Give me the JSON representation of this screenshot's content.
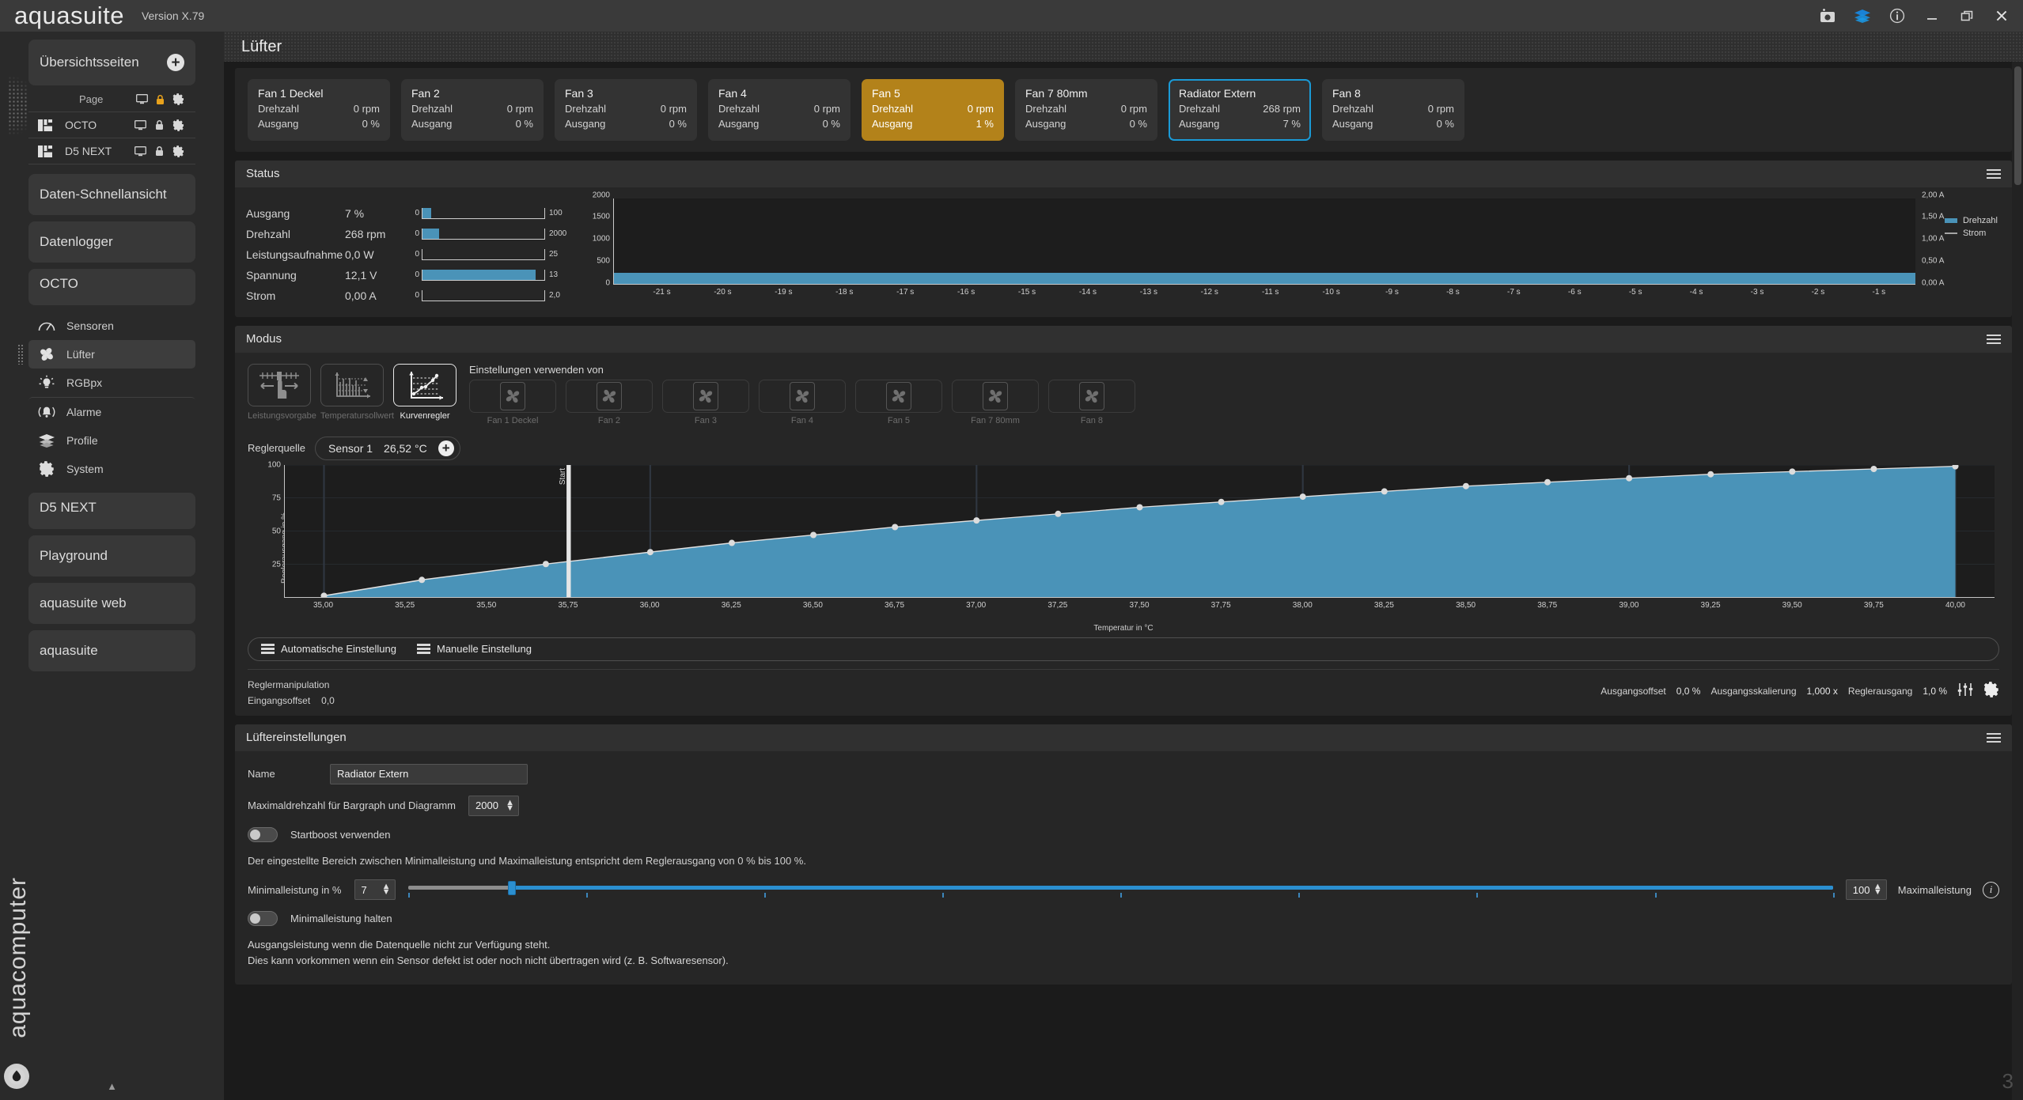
{
  "titlebar": {
    "brand": "aquasuite",
    "version": "Version X.79",
    "icons": [
      "screenshot-icon",
      "layers-icon",
      "info-icon",
      "minimize-icon",
      "restore-icon",
      "close-icon"
    ]
  },
  "sidebar": {
    "overview_group": "Übersichtsseiten",
    "page_label": "Page",
    "overview_pages": [
      {
        "label": "OCTO"
      },
      {
        "label": "D5 NEXT"
      }
    ],
    "groups": [
      {
        "label": "Daten-Schnellansicht"
      },
      {
        "label": "Datenlogger"
      },
      {
        "label": "OCTO"
      }
    ],
    "octo_items": [
      {
        "label": "Sensoren",
        "icon": "gauge-icon",
        "selected": false
      },
      {
        "label": "Lüfter",
        "icon": "fan-icon",
        "selected": true
      },
      {
        "label": "RGBpx",
        "icon": "bulb-icon",
        "selected": false
      },
      {
        "label": "Alarme",
        "icon": "bell-icon",
        "selected": false
      },
      {
        "label": "Profile",
        "icon": "layers-icon",
        "selected": false
      },
      {
        "label": "System",
        "icon": "gear-icon",
        "selected": false
      }
    ],
    "tail_groups": [
      {
        "label": "D5 NEXT"
      },
      {
        "label": "Playground"
      },
      {
        "label": "aquasuite web"
      },
      {
        "label": "aquasuite"
      }
    ],
    "vertical_brand": "aquacomputer"
  },
  "page": {
    "title": "Lüfter"
  },
  "fans": [
    {
      "name": "Fan 1 Deckel",
      "rpm_label": "Drehzahl",
      "rpm": "0 rpm",
      "out_label": "Ausgang",
      "out": "0 %",
      "state": "normal"
    },
    {
      "name": "Fan 2",
      "rpm_label": "Drehzahl",
      "rpm": "0 rpm",
      "out_label": "Ausgang",
      "out": "0 %",
      "state": "normal"
    },
    {
      "name": "Fan 3",
      "rpm_label": "Drehzahl",
      "rpm": "0 rpm",
      "out_label": "Ausgang",
      "out": "0 %",
      "state": "normal"
    },
    {
      "name": "Fan 4",
      "rpm_label": "Drehzahl",
      "rpm": "0 rpm",
      "out_label": "Ausgang",
      "out": "0 %",
      "state": "normal"
    },
    {
      "name": "Fan 5",
      "rpm_label": "Drehzahl",
      "rpm": "0 rpm",
      "out_label": "Ausgang",
      "out": "1 %",
      "state": "active"
    },
    {
      "name": "Fan 7 80mm",
      "rpm_label": "Drehzahl",
      "rpm": "0 rpm",
      "out_label": "Ausgang",
      "out": "0 %",
      "state": "normal"
    },
    {
      "name": "Radiator Extern",
      "rpm_label": "Drehzahl",
      "rpm": "268 rpm",
      "out_label": "Ausgang",
      "out": "7 %",
      "state": "selected"
    },
    {
      "name": "Fan 8",
      "rpm_label": "Drehzahl",
      "rpm": "0 rpm",
      "out_label": "Ausgang",
      "out": "0 %",
      "state": "normal"
    }
  ],
  "status": {
    "title": "Status",
    "rows": [
      {
        "label": "Ausgang",
        "value": "7 %",
        "min": "0",
        "max": "100",
        "pct": 7
      },
      {
        "label": "Drehzahl",
        "value": "268 rpm",
        "min": "0",
        "max": "2000",
        "pct": 13.4
      },
      {
        "label": "Leistungsaufnahme",
        "value": "0,0 W",
        "min": "0",
        "max": "25",
        "pct": 0
      },
      {
        "label": "Spannung",
        "value": "12,1 V",
        "min": "0",
        "max": "13",
        "pct": 93
      },
      {
        "label": "Strom",
        "value": "0,00 A",
        "min": "0",
        "max": "2,0",
        "pct": 0
      }
    ],
    "legend": [
      {
        "label": "Drehzahl",
        "type": "area"
      },
      {
        "label": "Strom",
        "type": "line"
      }
    ]
  },
  "chart_data": [
    {
      "type": "area",
      "title": "Status",
      "xlabel": "",
      "ylabel": "Drehzahl",
      "y2label": "Strom",
      "ylim": [
        0,
        2000
      ],
      "yticks": [
        0,
        500,
        1000,
        1500,
        2000
      ],
      "ytick_labels": [
        "0",
        "500",
        "1000",
        "1500",
        "2000"
      ],
      "y2lim": [
        0,
        2.0
      ],
      "y2tick_labels": [
        "0,00 A",
        "0,50 A",
        "1,00 A",
        "1,50 A",
        "2,00 A"
      ],
      "x_tick_labels": [
        "-21 s",
        "-20 s",
        "-19 s",
        "-18 s",
        "-17 s",
        "-16 s",
        "-15 s",
        "-14 s",
        "-13 s",
        "-12 s",
        "-11 s",
        "-10 s",
        "-9 s",
        "-8 s",
        "-7 s",
        "-6 s",
        "-5 s",
        "-4 s",
        "-3 s",
        "-2 s",
        "-1 s"
      ],
      "series": [
        {
          "name": "Drehzahl",
          "color": "#4a93b8",
          "constant_value": 268
        },
        {
          "name": "Strom",
          "color": "#a5a5a5",
          "constant_value": 0
        }
      ],
      "grid": false,
      "legend_position": "right"
    },
    {
      "type": "line",
      "title": "Kurvenregler",
      "xlabel": "Temperatur in °C",
      "ylabel": "Reglerausgang in %",
      "ylim": [
        0,
        100
      ],
      "ytick_labels": [
        "25",
        "50",
        "75",
        "100"
      ],
      "yticks": [
        25,
        50,
        75,
        100
      ],
      "xlim": [
        34.88,
        40.12
      ],
      "xtick_labels": [
        "35,00",
        "35,25",
        "35,50",
        "35,75",
        "36,00",
        "36,25",
        "36,50",
        "36,75",
        "37,00",
        "37,25",
        "37,50",
        "37,75",
        "38,00",
        "38,25",
        "38,50",
        "38,75",
        "39,00",
        "39,25",
        "39,50",
        "39,75",
        "40,00"
      ],
      "annotation": "Start",
      "annotation_x": 35.75,
      "points": [
        {
          "x": 35.0,
          "y": 1
        },
        {
          "x": 35.3,
          "y": 13
        },
        {
          "x": 35.68,
          "y": 25
        },
        {
          "x": 36.0,
          "y": 34
        },
        {
          "x": 36.25,
          "y": 41
        },
        {
          "x": 36.5,
          "y": 47
        },
        {
          "x": 36.75,
          "y": 53
        },
        {
          "x": 37.0,
          "y": 58
        },
        {
          "x": 37.25,
          "y": 63
        },
        {
          "x": 37.5,
          "y": 68
        },
        {
          "x": 37.75,
          "y": 72
        },
        {
          "x": 38.0,
          "y": 76
        },
        {
          "x": 38.25,
          "y": 80
        },
        {
          "x": 38.5,
          "y": 84
        },
        {
          "x": 38.75,
          "y": 87
        },
        {
          "x": 39.0,
          "y": 90
        },
        {
          "x": 39.25,
          "y": 93
        },
        {
          "x": 39.5,
          "y": 95
        },
        {
          "x": 39.75,
          "y": 97
        },
        {
          "x": 40.0,
          "y": 99
        }
      ],
      "fill_color": "#4a93b8",
      "line_color": "#e0e0e0"
    }
  ],
  "modus": {
    "title": "Modus",
    "modes": [
      {
        "label": "Leistungsvorgabe",
        "icon": "slider-hand-icon",
        "selected": false
      },
      {
        "label": "Temperatursollwert",
        "icon": "temp-setpoint-icon",
        "selected": false
      },
      {
        "label": "Kurvenregler",
        "icon": "curve-icon",
        "selected": true
      }
    ],
    "copy_title": "Einstellungen verwenden von",
    "copy_targets": [
      "Fan 1 Deckel",
      "Fan 2",
      "Fan 3",
      "Fan 4",
      "Fan 5",
      "Fan 7 80mm",
      "Fan 8"
    ]
  },
  "source": {
    "label": "Reglerquelle",
    "sensor_name": "Sensor 1",
    "sensor_value": "26,52 °C",
    "add_icon": "plus-icon"
  },
  "curve_actions": {
    "auto": "Automatische Einstellung",
    "manual": "Manuelle Einstellung"
  },
  "manipulation": {
    "title": "Reglermanipulation",
    "input_offset_label": "Eingangsoffset",
    "input_offset_value": "0,0",
    "output_offset_label": "Ausgangsoffset",
    "output_offset_value": "0,0 %",
    "output_scale_label": "Ausgangsskalierung",
    "output_scale_value": "1,000 x",
    "controller_out_label": "Reglerausgang",
    "controller_out_value": "1,0 %",
    "icons": [
      "sliders-icon",
      "gear-icon"
    ]
  },
  "fan_settings": {
    "title": "Lüftereinstellungen",
    "name_label": "Name",
    "name_value": "Radiator Extern",
    "maxrpm_label": "Maximaldrehzahl für Bargraph und Diagramm",
    "maxrpm_value": "2000",
    "startboost_label": "Startboost verwenden",
    "startboost_on": false,
    "range_note": "Der eingestellte Bereich zwischen Minimalleistung und Maximalleistung entspricht dem Reglerausgang von 0 % bis 100 %.",
    "min_label": "Minimalleistung in %",
    "min_value": "7",
    "max_value": "100",
    "max_label": "Maximalleistung",
    "hold_label": "Minimalleistung halten",
    "hold_on": false,
    "fallback_note_1": "Ausgangsleistung wenn die Datenquelle nicht zur Verfügung steht.",
    "fallback_note_2": "Dies kann vorkommen wenn ein Sensor defekt ist oder noch nicht übertragen wird (z. B. Softwaresensor).",
    "info_icon": "info-icon"
  },
  "colors": {
    "accent_blue": "#4a93b8",
    "selection_blue": "#1a9ad6",
    "active_gold": "#b3821a",
    "slider_blue": "#2b8fd0"
  },
  "page_number": "3"
}
